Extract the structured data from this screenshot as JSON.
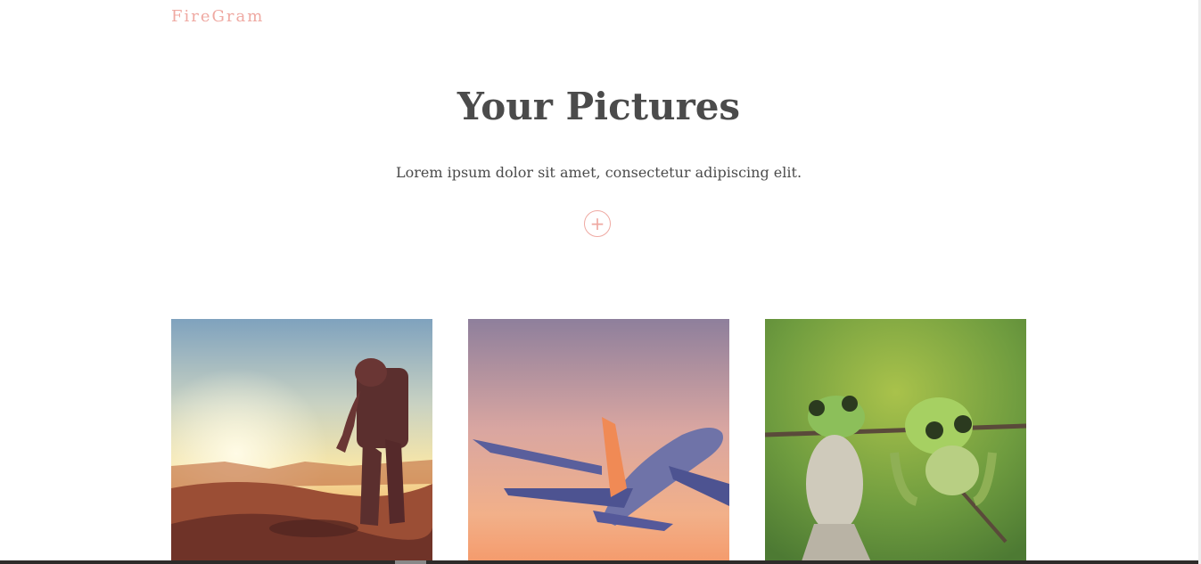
{
  "brand": {
    "name": "FireGram"
  },
  "header": {
    "title": "Your Pictures",
    "subtitle": "Lorem ipsum dolor sit amet, consectetur adipiscing elit."
  },
  "upload": {
    "label": "+"
  },
  "gallery": {
    "images": [
      {
        "subject": "astronaut walking on desert planet at sunset"
      },
      {
        "subject": "airplane flying in pink sky"
      },
      {
        "subject": "two green frogs hanging on a branch"
      }
    ]
  },
  "colors": {
    "accent": "#efa9a2",
    "heading": "#4b4b4b",
    "background": "#ffffff"
  }
}
